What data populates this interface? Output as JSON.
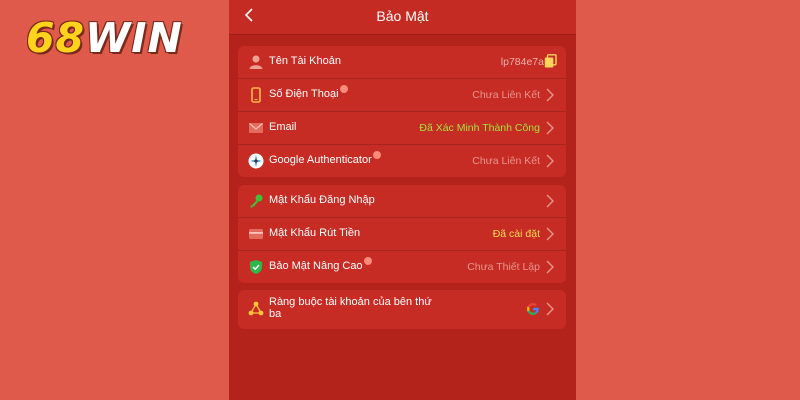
{
  "brand": {
    "number": "68",
    "word": "WIN"
  },
  "header": {
    "title": "Bảo Mật",
    "back_label": "‹"
  },
  "group1": [
    {
      "label": "Tên Tài Khoản",
      "value": "lp784e7a"
    },
    {
      "label": "Số Điện Thoại",
      "value": "Chưa Liên Kết"
    },
    {
      "label": "Email",
      "value": "Đã Xác Minh Thành Công"
    },
    {
      "label": "Google Authenticator",
      "value": "Chưa Liên Kết"
    }
  ],
  "group2": [
    {
      "label": "Mật Khẩu Đăng Nhập",
      "value": ""
    },
    {
      "label": "Mật Khẩu Rút Tiền",
      "value": "Đã cài đặt"
    },
    {
      "label": "Bảo Mật Nâng Cao",
      "value": "Chưa Thiết Lập"
    }
  ],
  "group3": [
    {
      "label": "Ràng buộc tài khoản của bên thứ ba"
    }
  ],
  "colors": {
    "page_bg": "#e05a4c",
    "panel_bg": "#b3231c",
    "card_bg": "#c62b24",
    "verified": "#a4e43a",
    "set": "#ffdd55",
    "muted": "#e8958c"
  }
}
